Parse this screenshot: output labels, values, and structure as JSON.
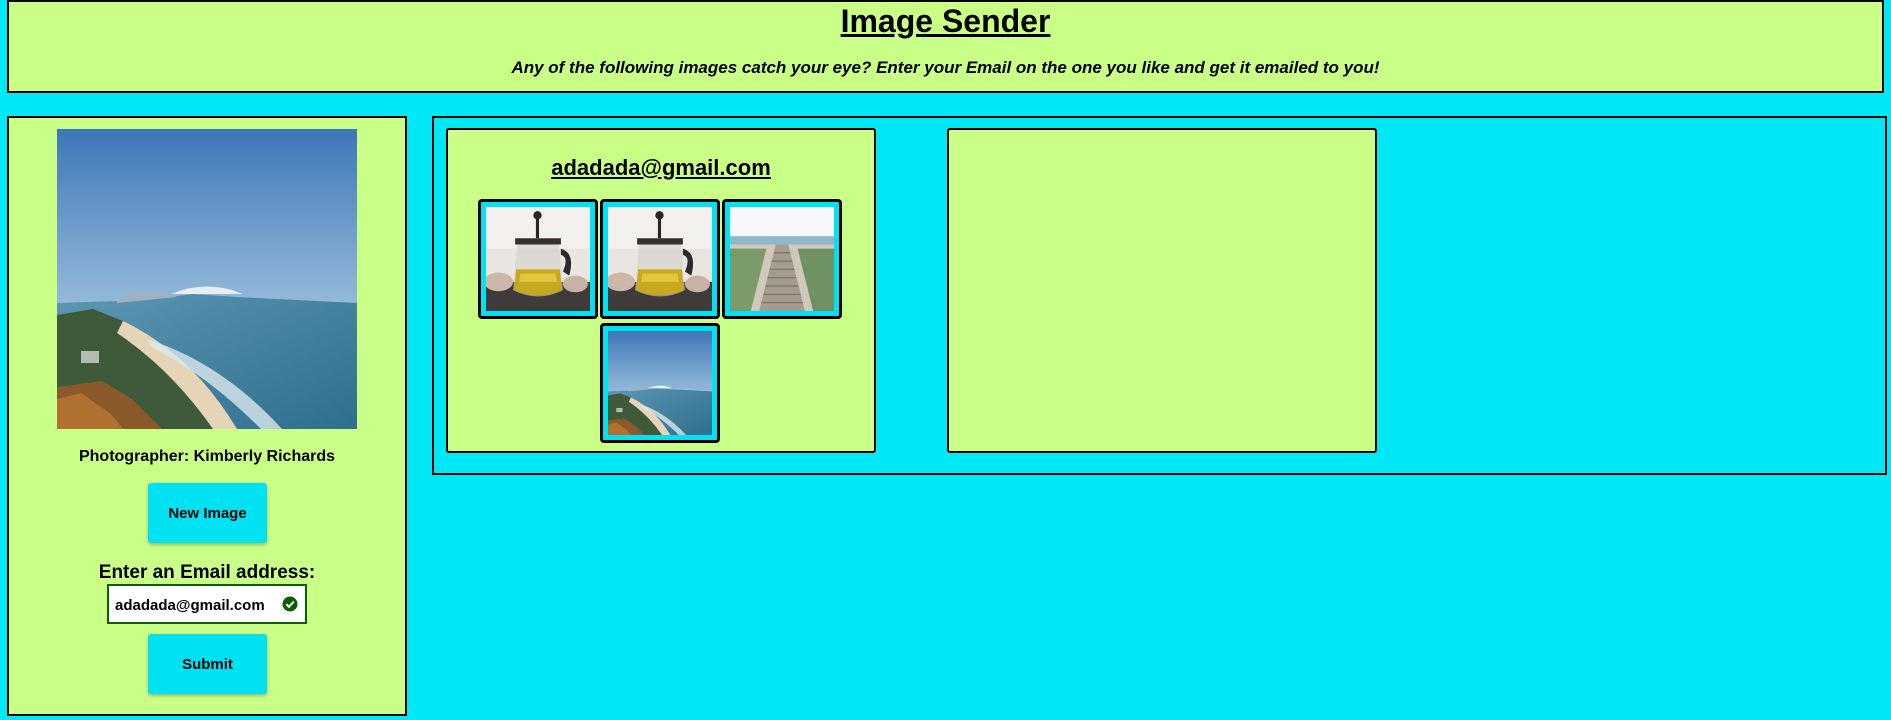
{
  "header": {
    "title": "Image Sender",
    "subtitle": "Any of the following images catch your eye? Enter your Email on the one you like and get it emailed to you!"
  },
  "sidebar": {
    "image_icon": "coastal-landscape-photo",
    "photographer": "Photographer: Kimberly Richards",
    "new_image_label": "New Image",
    "email_label": "Enter an Email address:",
    "email_value": "adadada@gmail.com",
    "valid_icon": "check-circle-icon",
    "submit_label": "Submit"
  },
  "gallery": {
    "cards": [
      {
        "email": "adadada@gmail.com",
        "thumbnails": [
          {
            "icon": "teapot-photo"
          },
          {
            "icon": "teapot-photo"
          },
          {
            "icon": "beach-boardwalk-photo"
          },
          {
            "icon": "coastal-landscape-photo"
          }
        ]
      },
      {
        "email": "",
        "thumbnails": []
      }
    ]
  },
  "colors": {
    "background": "#00e8f5",
    "panel": "#caff87",
    "button": "#00e1f1",
    "valid_border": "#0b5c0b"
  }
}
